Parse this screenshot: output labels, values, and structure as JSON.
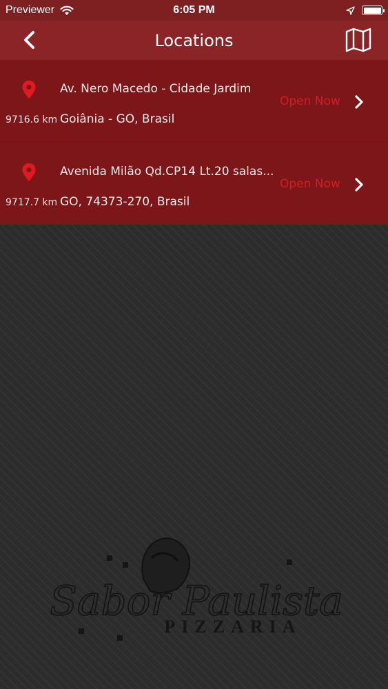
{
  "status_bar": {
    "carrier": "Previewer",
    "time": "6:05 PM",
    "wifi_icon": "wifi-icon",
    "location_icon": "location-arrow-icon",
    "battery_icon": "battery-icon",
    "battery_level": 1.0
  },
  "nav": {
    "title": "Locations",
    "back_icon": "chevron-left-icon",
    "map_icon": "map-icon"
  },
  "locations": [
    {
      "distance": "9716.6 km",
      "address_line1": "Av. Nero Macedo - Cidade Jardim",
      "address_line2": "Goiânia - GO, Brasil",
      "status": "Open Now"
    },
    {
      "distance": "9717.7 km",
      "address_line1": "Avenida Milão Qd.CP14 Lt.20 salas...",
      "address_line2": "GO, 74373-270, Brasil",
      "status": "Open Now"
    }
  ],
  "logo": {
    "script_text": "Sabor Paulista",
    "sub_text": "PIZZARIA"
  },
  "colors": {
    "status_bar": "#7e1f22",
    "nav_bar": "#8a2427",
    "list_background": "#7d1618",
    "pin": "#e11a21",
    "open_status": "#d51d22",
    "page_background": "#2c2c2c"
  }
}
